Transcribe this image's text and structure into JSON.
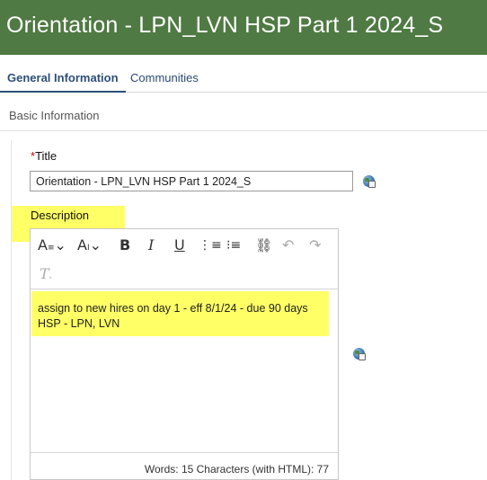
{
  "header": {
    "title": "Orientation - LPN_LVN HSP Part 1 2024_S"
  },
  "tabs": [
    {
      "label": "General Information",
      "active": true
    },
    {
      "label": "Communities",
      "active": false
    }
  ],
  "section": {
    "title": "Basic Information"
  },
  "title_field": {
    "required_marker": "*",
    "label": "Title",
    "value": "Orientation - LPN_LVN HSP Part 1 2024_S"
  },
  "description_field": {
    "label": "Description",
    "text_lines": [
      "assign to new hires on day 1 - eff 8/1/24 - due 90 days",
      "HSP - LPN, LVN"
    ],
    "status": "Words: 15  Characters (with HTML): 77"
  },
  "toolbar": {
    "buttons": [
      "font-style-icon",
      "font-size-icon",
      "bold-icon",
      "italic-icon",
      "underline-icon",
      "numbered-list-icon",
      "bulleted-list-icon",
      "link-icon",
      "undo-icon",
      "redo-icon",
      "clear-formatting-icon"
    ]
  },
  "colors": {
    "header_bg": "#4f7a43",
    "highlight": "#ffff66",
    "tab_active": "#2c4f79"
  }
}
